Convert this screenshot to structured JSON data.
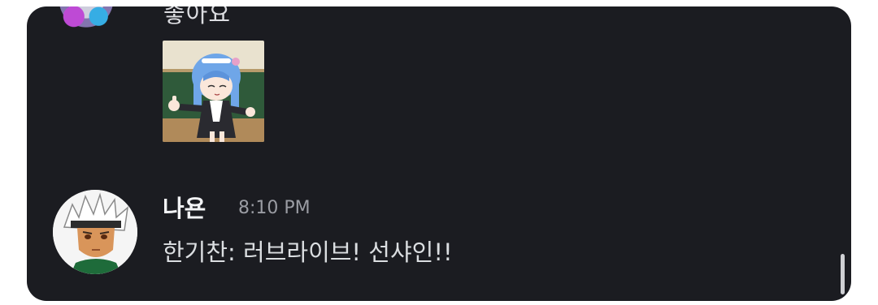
{
  "previous_message": {
    "text_fragment": "좋아요",
    "sticker_icon": "anime-girl-thumbs-up-sticker"
  },
  "message": {
    "author": "나욘",
    "timestamp": "8:10 PM",
    "text": "한기찬: 러브라이브! 선샤인!!",
    "avatar_icon": "white-haired-anime-boy-avatar"
  },
  "colors": {
    "panel_background": "#1b1c21",
    "author": "#f2f3f5",
    "timestamp": "#9a9ca3",
    "message_text": "#dbdee1"
  }
}
